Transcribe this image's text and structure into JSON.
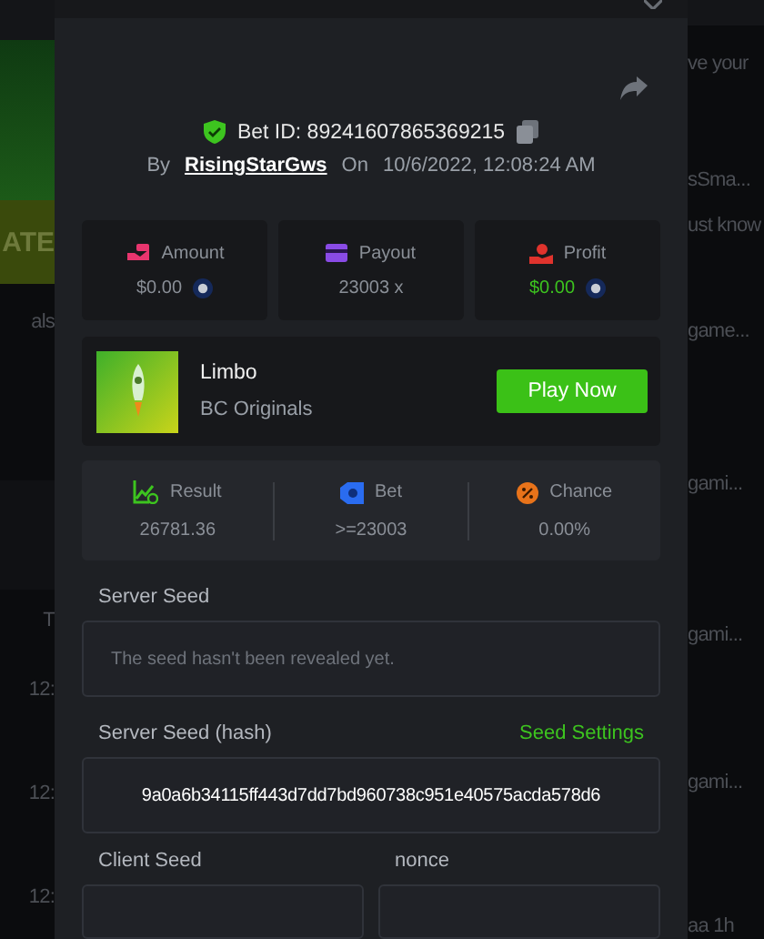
{
  "backdrop": {
    "left": [
      "ATE",
      "als",
      "T",
      "12:",
      "12:",
      "12:"
    ],
    "right": [
      "ve your",
      "sSma...",
      "ust know",
      "game...",
      "gami...",
      "gami...",
      "gami...",
      "aa  1h"
    ]
  },
  "modal": {
    "bet_id": "Bet ID: 89241607865369215",
    "by_label": "By",
    "user": "RisingStarGws",
    "on_label": "On",
    "date": "10/6/2022, 12:08:24 AM",
    "stats": [
      {
        "kind": "amount",
        "label": "Amount",
        "value": "$0.00",
        "coin": true,
        "positive": false
      },
      {
        "kind": "payout",
        "label": "Payout",
        "value": "23003 x",
        "coin": false,
        "positive": false
      },
      {
        "kind": "profit",
        "label": "Profit",
        "value": "$0.00",
        "coin": true,
        "positive": true
      }
    ],
    "game": {
      "name": "Limbo",
      "provider": "BC Originals",
      "button": "Play Now"
    },
    "results": [
      {
        "kind": "result",
        "label": "Result",
        "value": "26781.36"
      },
      {
        "kind": "bet",
        "label": "Bet",
        "value": ">=23003"
      },
      {
        "kind": "chance",
        "label": "Chance",
        "value": "0.00%"
      }
    ],
    "server_seed": {
      "label": "Server Seed",
      "placeholder": "The seed hasn't been revealed yet."
    },
    "hash": {
      "label": "Server Seed (hash)",
      "link": "Seed Settings",
      "value": "9a0a6b34115ff443d7dd7bd960738c951e40575acda578d6"
    },
    "client_seed": {
      "label": "Client Seed"
    },
    "nonce": {
      "label": "nonce"
    }
  }
}
